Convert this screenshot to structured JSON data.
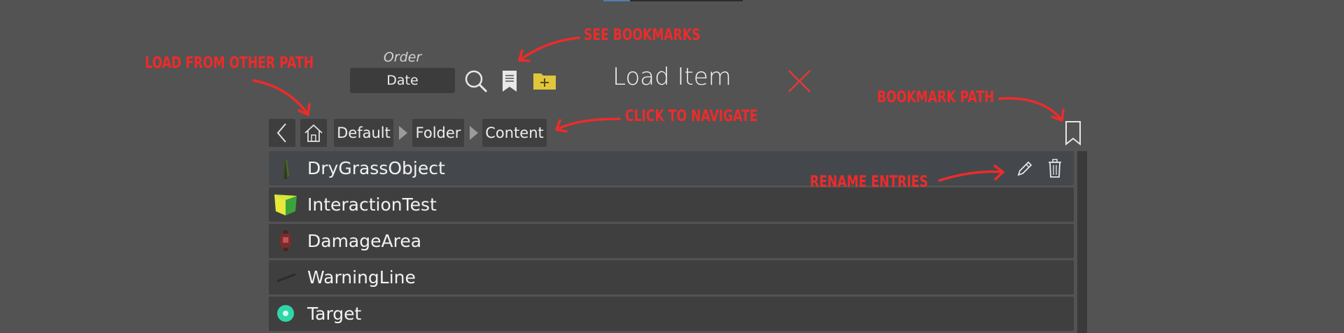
{
  "toolbar": {
    "order_label": "Order",
    "order_value": "Date",
    "title": "Load Item",
    "folder_color": "#e0c63b",
    "close_color": "#e03a3a"
  },
  "breadcrumbs": [
    "Default",
    "Folder",
    "Content"
  ],
  "items": [
    {
      "name": "DryGrassObject",
      "icon": "grass-icon",
      "selected": true
    },
    {
      "name": "InteractionTest",
      "icon": "cube-icon",
      "selected": false
    },
    {
      "name": "DamageArea",
      "icon": "lantern-icon",
      "selected": false
    },
    {
      "name": "WarningLine",
      "icon": "line-icon",
      "selected": false
    },
    {
      "name": "Target",
      "icon": "target-icon",
      "selected": false
    }
  ],
  "annotations": {
    "see_bookmarks": "SEE BOOKMARKS",
    "load_from_other_path": "LOAD FROM OTHER PATH",
    "click_to_navigate": "CLICK TO NAVIGATE",
    "bookmark_path": "BOOKMARK PATH",
    "rename_entries": "RENAME ENTRIES",
    "color": "#ee2b2b"
  }
}
